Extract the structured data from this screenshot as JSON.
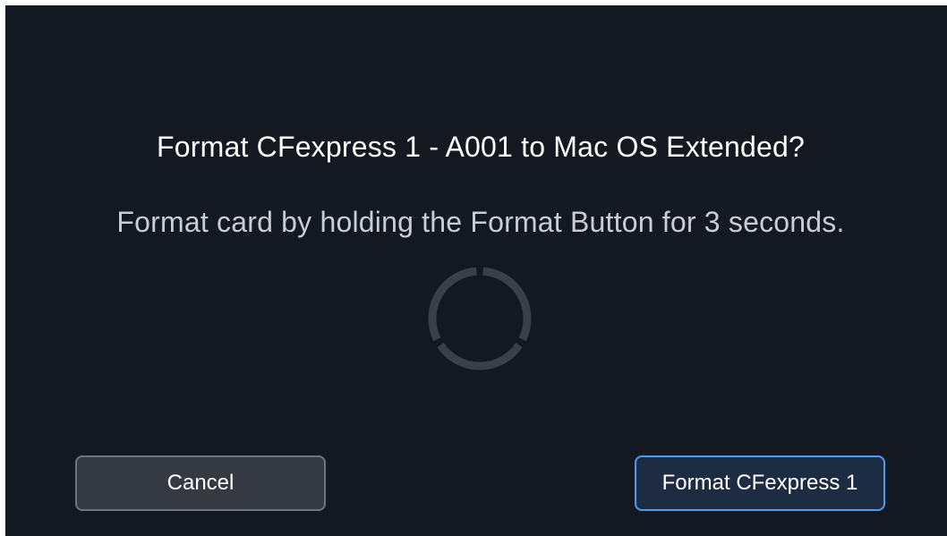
{
  "dialog": {
    "title": "Format CFexpress 1 - A001 to Mac OS Extended?",
    "message": "Format card by holding the Format Button for 3 seconds.",
    "hold_progress": 0,
    "hold_segments": 3
  },
  "buttons": {
    "cancel_label": "Cancel",
    "format_label": "Format CFexpress 1"
  },
  "colors": {
    "background": "#141921",
    "ring_track": "#3a3f48",
    "accent_border": "#4a9cf5"
  },
  "icons": {
    "progress": "segmented-progress-ring-icon"
  }
}
